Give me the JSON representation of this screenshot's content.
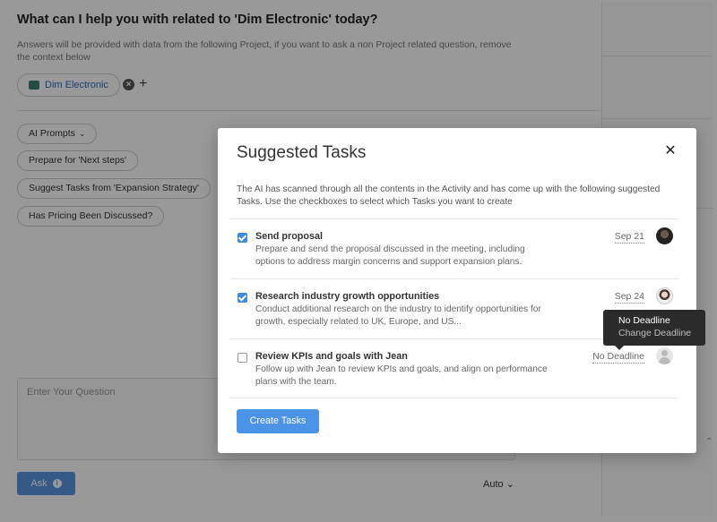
{
  "assistant": {
    "title": "What can I help you with related to 'Dim Electronic' today?",
    "description": "Answers will be provided with data from the following Project, if you want to ask a non Project related question, remove the context below",
    "context_chip": "Dim Electronic",
    "prompts_dropdown": "AI Prompts",
    "prompts": [
      "Prepare for 'Next steps'",
      "Suggest Tasks from 'Expansion Strategy'",
      "Has Pricing Been Discussed?"
    ],
    "question_placeholder": "Enter Your Question",
    "ask_label": "Ask",
    "model_select": "Auto"
  },
  "modal": {
    "title": "Suggested Tasks",
    "close_icon": "close-icon",
    "description": "The AI has scanned through all the contents in the Activity and has come up with the following suggested Tasks. Use the checkboxes to select which Tasks you want to create",
    "tasks": [
      {
        "checked": true,
        "title": "Send proposal",
        "description": "Prepare and send the proposal discussed in the meeting, including options to address margin concerns and support expansion plans.",
        "due": "Sep 21"
      },
      {
        "checked": true,
        "title": "Research industry growth opportunities",
        "description": "Conduct additional research on the industry to identify opportunities for growth, especially related to UK, Europe, and US...",
        "due": "Sep 24"
      },
      {
        "checked": false,
        "title": "Review KPIs and goals with Jean",
        "description": "Follow up with Jean to review KPIs and goals, and align on performance plans with the team.",
        "due": "No Deadline"
      }
    ],
    "create_button": "Create Tasks"
  },
  "tooltip": {
    "line1": "No Deadline",
    "line2": "Change Deadline"
  },
  "colors": {
    "accent": "#4b93e6",
    "checkbox": "#3f8ae0",
    "link": "#2a6db5"
  }
}
